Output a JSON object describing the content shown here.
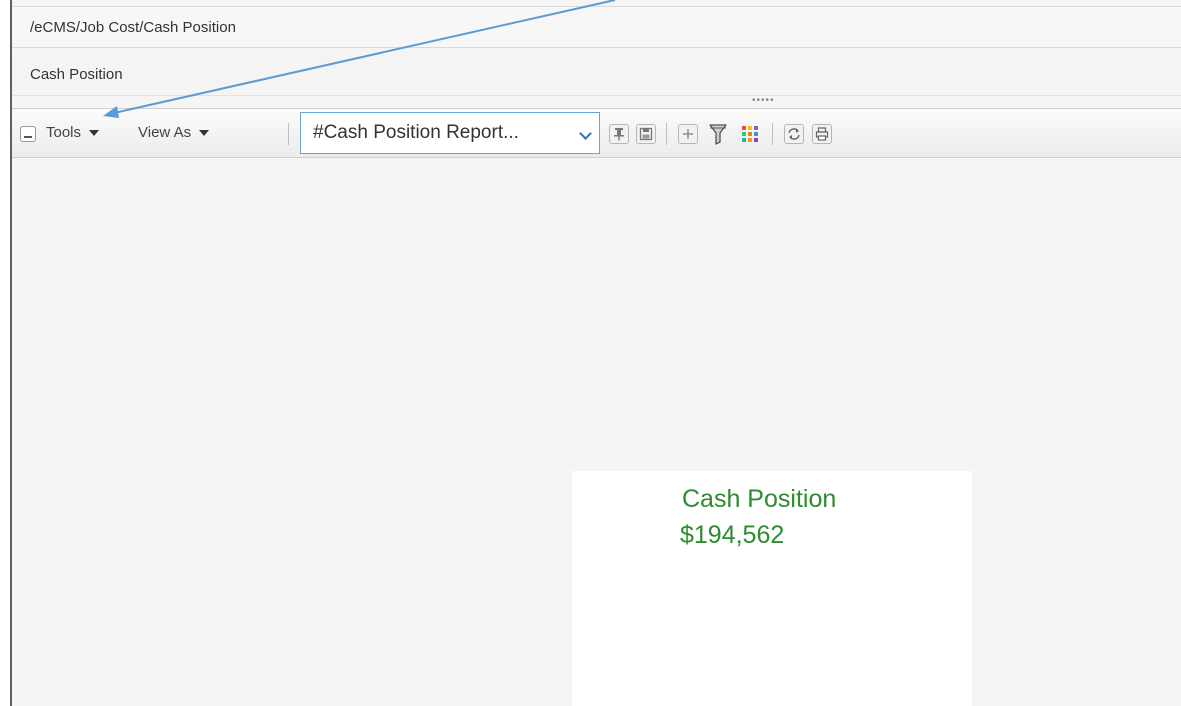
{
  "breadcrumb": {
    "path": "/eCMS/Job Cost/Cash Position"
  },
  "page": {
    "title": "Cash Position"
  },
  "toolbar": {
    "tools_label": "Tools",
    "view_as_label": "View As",
    "report_select": {
      "selected": "#Cash Position Report..."
    },
    "icons": [
      "collapse-icon",
      "pin-icon",
      "save-icon",
      "add-icon",
      "filter-icon",
      "color-grid-icon",
      "refresh-icon",
      "print-icon"
    ]
  },
  "kpi": {
    "title": "Cash Position",
    "value": "$194,562",
    "color": "#2e8b2e"
  },
  "annotation": {
    "arrow_color": "#5b9bd5"
  }
}
